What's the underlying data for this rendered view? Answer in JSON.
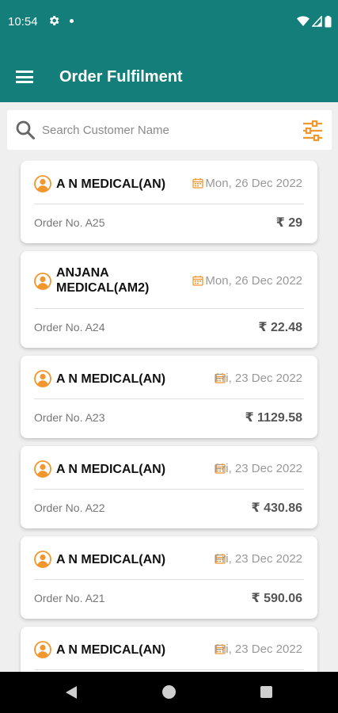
{
  "status_bar": {
    "time": "10:54",
    "icons": [
      "settings-icon",
      "notification-dot",
      "wifi-icon",
      "signal-icon",
      "battery-icon"
    ]
  },
  "app_bar": {
    "title": "Order Fulfilment",
    "menu_icon": "hamburger-menu-icon"
  },
  "search": {
    "placeholder": "Search Customer Name",
    "value": "",
    "filter_icon": "filter-sliders-icon"
  },
  "orders": [
    {
      "customer": "A N MEDICAL(AN)",
      "date": "Mon, 26 Dec 2022",
      "order_no": "Order No. A25",
      "amount": "₹ 29"
    },
    {
      "customer": "ANJANA MEDICAL(AM2)",
      "date": "Mon, 26 Dec 2022",
      "order_no": "Order No. A24",
      "amount": "₹ 22.48"
    },
    {
      "customer": "A N MEDICAL(AN)",
      "date": "Fri, 23 Dec 2022",
      "order_no": "Order No. A23",
      "amount": "₹ 1129.58"
    },
    {
      "customer": "A N MEDICAL(AN)",
      "date": "Fri, 23 Dec 2022",
      "order_no": "Order No. A22",
      "amount": "₹ 430.86"
    },
    {
      "customer": "A N MEDICAL(AN)",
      "date": "Fri, 23 Dec 2022",
      "order_no": "Order No. A21",
      "amount": "₹ 590.06"
    },
    {
      "customer": "A N MEDICAL(AN)",
      "date": "Fri, 23 Dec 2022",
      "order_no": "",
      "amount": ""
    }
  ],
  "colors": {
    "header": "#147f7a",
    "accent": "#f2972e",
    "background": "#efefef"
  },
  "nav_bar": {
    "icons": [
      "back-icon",
      "home-icon",
      "recents-icon"
    ]
  }
}
